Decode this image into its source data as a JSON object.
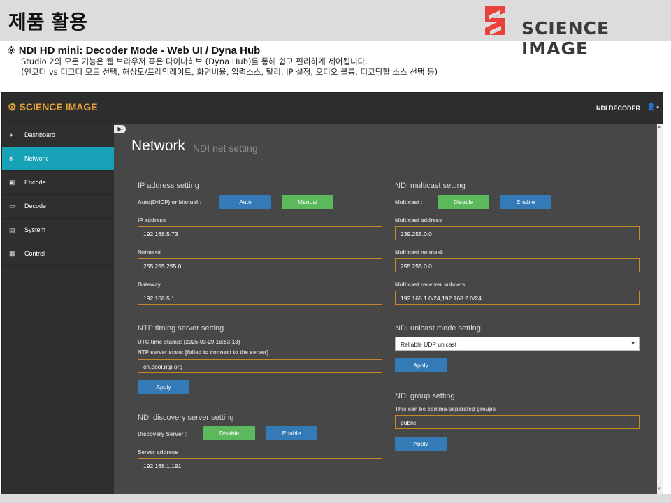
{
  "slide": {
    "title": "제품 활용",
    "brand_text": "SCIENCE IMAGE",
    "subtitle_mark": "※",
    "subtitle": "NDI HD mini: Decoder Mode - Web UI / Dyna Hub",
    "desc_line1": "Studio 2의 모든 기능은 웹 브라우저 혹은 다이나허브 (Dyna Hub)를 통해 쉽고 편리하게 제어됩니다.",
    "desc_line2": "(인코더 vs 디코더 모드 선택, 해상도/프레임레이트, 화면비율, 입력소스, 탈리, IP 설정, 오디오 볼륨, 디코딩할 소스 선택 등)"
  },
  "app": {
    "logo": "SCIENCE IMAGE",
    "mode_label": "NDI DECODER",
    "colors": {
      "accent": "#e8a23a",
      "active_nav": "#17a2b8",
      "blue": "#337ab7",
      "green": "#5cb85c",
      "field_border": "#c48a2a"
    },
    "sidebar": {
      "items": [
        {
          "label": "Dashboard",
          "icon": "dashboard-icon"
        },
        {
          "label": "Network",
          "icon": "network-icon",
          "active": true
        },
        {
          "label": "Encode",
          "icon": "encode-icon"
        },
        {
          "label": "Decode",
          "icon": "decode-icon"
        },
        {
          "label": "System",
          "icon": "system-icon"
        },
        {
          "label": "Control",
          "icon": "control-icon"
        }
      ]
    },
    "page": {
      "title": "Network",
      "subtitle": "NDI net setting"
    },
    "ip": {
      "title": "IP address setting",
      "mode_label": "Auto(DHCP) or Manual :",
      "auto_btn": "Auto",
      "manual_btn": "Manual",
      "ip_label": "IP address",
      "ip_value": "192.168.5.73",
      "netmask_label": "Netmask",
      "netmask_value": "255.255.255.0",
      "gateway_label": "Gateway",
      "gateway_value": "192.168.5.1"
    },
    "ntp": {
      "title": "NTP timing server setting",
      "utc": "UTC time stamp: [2025-03-29 16:53:13]",
      "state": "NTP server state: [failed to connect to the server]",
      "value": "cn.pool.ntp.org",
      "apply": "Apply"
    },
    "discovery": {
      "title": "NDI discovery server setting",
      "label": "Discovery Server :",
      "disable": "Disable",
      "enable": "Enable",
      "addr_label": "Server address",
      "addr_value": "192.168.1.191"
    },
    "multicast": {
      "title": "NDI multicast setting",
      "label": "Multicast :",
      "disable": "Disable",
      "enable": "Enable",
      "addr_label": "Multicast address",
      "addr_value": "239.255.0.0",
      "netmask_label": "Multicast netmask",
      "netmask_value": "255.255.0.0",
      "subnets_label": "Multicast receiver subnets",
      "subnets_value": "192.168.1.0/24,192.168.2.0/24"
    },
    "unicast": {
      "title": "NDI unicast mode setting",
      "selected": "Reliable UDP unicast",
      "apply": "Apply"
    },
    "group": {
      "title": "NDI group setting",
      "hint": "This can be comma-separated groups",
      "value": "public",
      "apply": "Apply"
    }
  }
}
